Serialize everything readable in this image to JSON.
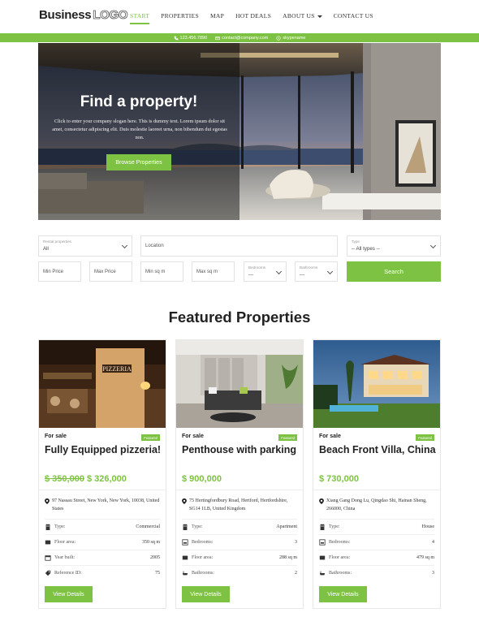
{
  "header": {
    "logo_bold": "Business",
    "logo_outline": "LOGO",
    "nav": [
      {
        "label": "START",
        "active": true
      },
      {
        "label": "PROPERTIES"
      },
      {
        "label": "MAP"
      },
      {
        "label": "HOT DEALS"
      },
      {
        "label": "ABOUT US"
      },
      {
        "label": "CONTACT US"
      }
    ]
  },
  "contact": {
    "phone": "123.456.7890",
    "email": "contact@company.com",
    "skype": "skypename"
  },
  "hero": {
    "title": "Find a property!",
    "slogan": "Click to enter your company slogan here. This is dummy text. Lorem ipsum dolor sit amet, consectetur adipiscing elit. Duis molestie laoreet urna, non bibendum dui egestas non.",
    "button": "Browse Properties"
  },
  "search": {
    "rental_label": "Rental properties",
    "rental_value": "All",
    "location_placeholder": "Location",
    "type_label": "Type",
    "type_value": "-- All types --",
    "min_price": "Min Price",
    "max_price": "Max Price",
    "min_sqm": "Min sq m",
    "max_sqm": "Max sq m",
    "bedrooms_label": "Bedrooms",
    "bedrooms_value": "---",
    "bathrooms_label": "Bathrooms",
    "bathrooms_value": "---",
    "button": "Search"
  },
  "featured_title": "Featured Properties",
  "cards": [
    {
      "status": "For sale",
      "badge": "Featured",
      "title": "Fully Equipped pizzeria!",
      "old_price": "$ 350,000",
      "price": "$ 326,000",
      "address": "97 Nassau Street, New York, New York, 10038, United States",
      "specs": [
        {
          "icon": "building-icon",
          "label": "Type:",
          "value": "Commercial"
        },
        {
          "icon": "floor-area-icon",
          "label": "Floor area:",
          "value": "350 sq m"
        },
        {
          "icon": "calendar-icon",
          "label": "Year built:",
          "value": "2005"
        },
        {
          "icon": "tag-icon",
          "label": "Reference ID:",
          "value": "75"
        }
      ],
      "button": "View Details"
    },
    {
      "status": "For sale",
      "badge": "Featured",
      "title": "Penthouse with parking",
      "old_price": "",
      "price": "$ 900,000",
      "address": "75 Hertingfordbury Road, Hertford, Hertfordshire, SG14 1LB, United Kingdom",
      "specs": [
        {
          "icon": "building-icon",
          "label": "Type:",
          "value": "Apartment"
        },
        {
          "icon": "bed-icon",
          "label": "Bedrooms:",
          "value": "3"
        },
        {
          "icon": "floor-area-icon",
          "label": "Floor area:",
          "value": "288 sq m"
        },
        {
          "icon": "bath-icon",
          "label": "Bathrooms:",
          "value": "2"
        }
      ],
      "button": "View Details"
    },
    {
      "status": "For sale",
      "badge": "Featured",
      "title": "Beach Front Villa, China",
      "old_price": "",
      "price": "$ 730,000",
      "address": "Xiang Gang Dong Lu, Qingdao Shi, Hainan Sheng, 266000, China",
      "specs": [
        {
          "icon": "building-icon",
          "label": "Type:",
          "value": "House"
        },
        {
          "icon": "bed-icon",
          "label": "Bedrooms:",
          "value": "4"
        },
        {
          "icon": "floor-area-icon",
          "label": "Floor area:",
          "value": "479 sq m"
        },
        {
          "icon": "bath-icon",
          "label": "Bathrooms:",
          "value": "3"
        }
      ],
      "button": "View Details"
    }
  ],
  "colors": {
    "accent": "#7dc242",
    "text": "#222222"
  }
}
